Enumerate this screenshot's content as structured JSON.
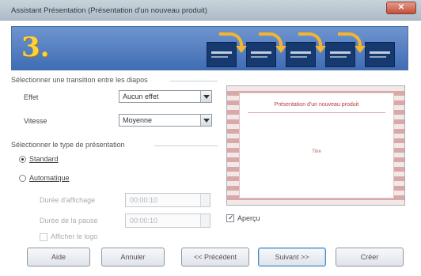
{
  "window": {
    "title": "Assistant Présentation (Présentation d'un nouveau produit)"
  },
  "header": {
    "step_number": "3."
  },
  "transition": {
    "group_label": "Sélectionner une transition entre les diapos",
    "effect_label": "Effet",
    "effect_value": "Aucun effet",
    "speed_label": "Vitesse",
    "speed_value": "Moyenne"
  },
  "presentation_type": {
    "group_label": "Sélectionner le type de présentation",
    "standard_label": "Standard",
    "standard_selected": true,
    "automatic_label": "Automatique",
    "page_duration_label": "Durée d'affichage",
    "page_duration_value": "00:00:10",
    "pause_duration_label": "Durée de la pause",
    "pause_duration_value": "00:00:10",
    "show_logo_label": "Afficher le logo"
  },
  "preview": {
    "slide_title": "Présentation d'un nouveau produit",
    "slide_subtitle": "Titre",
    "checkbox_label": "Aperçu",
    "checkbox_checked": true
  },
  "buttons": {
    "help": "Aide",
    "cancel": "Annuler",
    "previous": "<< Précédent",
    "next": "Suivant >>",
    "create": "Créer"
  },
  "colors": {
    "banner": "#4f7cc2",
    "accent_arrow": "#f3b430",
    "step_number": "#ffd23a"
  }
}
